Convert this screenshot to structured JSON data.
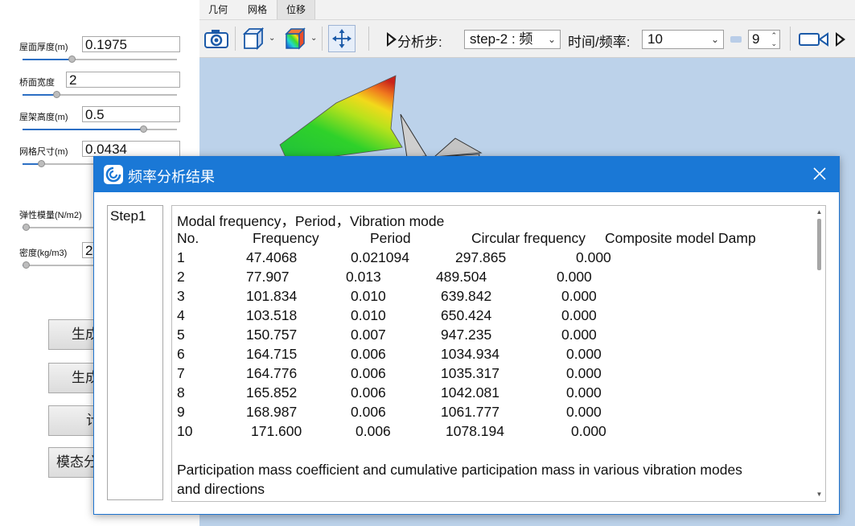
{
  "left_panel": {
    "params": [
      {
        "label": "屋面厚度(m)",
        "value": "0.1975",
        "slider_fraction": 0.32
      },
      {
        "label": "桥面宽度",
        "value": "2",
        "slider_fraction": 0.22
      },
      {
        "label": "屋架高度(m)",
        "value": "0.5",
        "slider_fraction": 0.78
      },
      {
        "label": "网格尺寸(m)",
        "value": "0.0434",
        "slider_fraction": 0.12
      },
      {
        "label": "弹性模量(N/m2)",
        "value": "",
        "slider_fraction": 0.02
      },
      {
        "label": "密度(kg/m3)",
        "value": "2",
        "slider_fraction": 0.02
      }
    ],
    "buttons": [
      "生成",
      "生成",
      "计",
      "模态分"
    ]
  },
  "viewer": {
    "tabs": [
      "几何",
      "网格",
      "位移"
    ],
    "active_tab": "位移",
    "toolbar": {
      "step_label": "分析步:",
      "step_value": "step-2 : 频",
      "time_label": "时间/频率:",
      "time_value": "10",
      "frame_value": "9"
    }
  },
  "dialog": {
    "title": "频率分析结果",
    "steps": [
      "Step1"
    ],
    "heading": "Modal frequency，Period，Vibration mode",
    "columns": [
      "No.",
      "Frequency",
      "Period",
      "Circular frequency",
      "Composite model Damp"
    ],
    "rows": [
      [
        "1",
        "47.4068",
        "0.021094",
        "297.865",
        "0.000"
      ],
      [
        "2",
        "77.907",
        "0.013",
        "489.504",
        "0.000"
      ],
      [
        "3",
        "101.834",
        "0.010",
        "639.842",
        "0.000"
      ],
      [
        "4",
        "103.518",
        "0.010",
        "650.424",
        "0.000"
      ],
      [
        "5",
        "150.757",
        "0.007",
        "947.235",
        "0.000"
      ],
      [
        "6",
        "164.715",
        "0.006",
        "1034.934",
        "0.000"
      ],
      [
        "7",
        "164.776",
        "0.006",
        "1035.317",
        "0.000"
      ],
      [
        "8",
        "165.852",
        "0.006",
        "1042.081",
        "0.000"
      ],
      [
        "9",
        "168.987",
        "0.006",
        "1061.777",
        "0.000"
      ],
      [
        "10",
        "171.600",
        "0.006",
        "1078.194",
        "0.000"
      ]
    ],
    "footer_line1": "Participation mass coefficient and cumulative participation mass in various vibration modes",
    "footer_line2": "and directions"
  },
  "colors": {
    "title_bar": "#1a78d6",
    "viewport_bg": "#bcd2ea",
    "slider_fill": "#2c6fc4"
  }
}
